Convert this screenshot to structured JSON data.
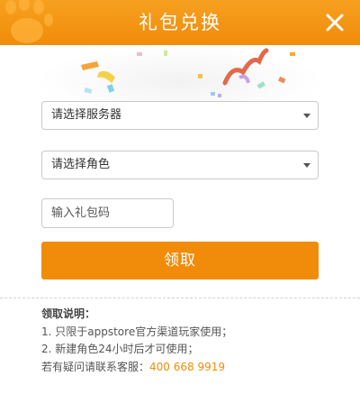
{
  "header": {
    "title": "礼包兑换",
    "background": "#f39614",
    "logo_icon": "paw-logo-icon",
    "close_icon": "close-icon"
  },
  "form": {
    "server_select": {
      "selected": "请选择服务器"
    },
    "role_select": {
      "selected": "请选择角色"
    },
    "gift_code": {
      "placeholder": "输入礼包码",
      "value": ""
    },
    "claim_button_label": "领取"
  },
  "notes": {
    "title": "领取说明：",
    "items": [
      "1. 只限于appstore官方渠道玩家使用；",
      "2. 新建角色24小时后才可使用；"
    ],
    "contact_prefix": "若有疑问请联系客服：",
    "contact_phone": "400 668 9919"
  },
  "colors": {
    "accent": "#f08c0a",
    "text": "#555555",
    "border": "#c9c9c9"
  }
}
